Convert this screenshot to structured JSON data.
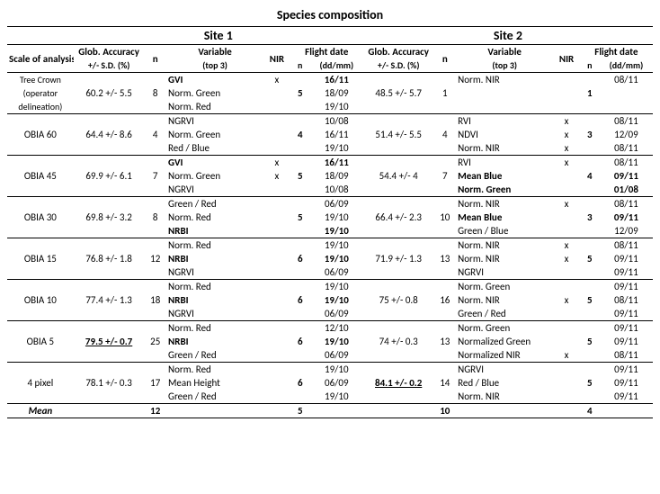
{
  "title": "Species composition",
  "sites": [
    "Site 1",
    "Site 2"
  ],
  "headers": {
    "scale": "Scale of analysis",
    "acc": "Glob. Accuracy",
    "acc_sub": "+/- S.D. (%)",
    "n": "n",
    "variable": "Variable",
    "var_sub": "(top 3)",
    "nir": "NIR",
    "flight": "Flight date",
    "flight_sub": "(dd/mm)"
  },
  "rows": [
    {
      "scale": [
        "Tree Crown",
        "(operator",
        "delineation)"
      ],
      "s1": {
        "acc": "60.2 +/- 5.5",
        "n": "8",
        "vars": [
          "GVI",
          "Norm. Green",
          "Norm. Red"
        ],
        "var_bold": [
          true,
          false,
          false
        ],
        "nir": [
          "x",
          "",
          ""
        ],
        "fn": "5",
        "fd": [
          "16/11",
          "18/09",
          "19/10"
        ],
        "fd_bold": [
          true,
          false,
          false
        ]
      },
      "s2": {
        "acc": "48.5 +/- 5.7",
        "n": "1",
        "vars": [
          "Norm. NIR",
          "",
          ""
        ],
        "var_bold": [
          false,
          false,
          false
        ],
        "nir": [
          "",
          "",
          ""
        ],
        "fn": "1",
        "fd": [
          "08/11",
          "",
          ""
        ],
        "fd_bold": [
          false,
          false,
          false
        ]
      }
    },
    {
      "scale": [
        "OBIA 60",
        "",
        ""
      ],
      "s1": {
        "acc": "64.4 +/- 8.6",
        "n": "4",
        "vars": [
          "NGRVI",
          "Norm. Green",
          "Red / Blue"
        ],
        "var_bold": [
          false,
          false,
          false
        ],
        "nir": [
          "",
          "",
          ""
        ],
        "fn": "4",
        "fd": [
          "10/08",
          "16/11",
          "19/10"
        ],
        "fd_bold": [
          false,
          false,
          false
        ]
      },
      "s2": {
        "acc": "51.4 +/- 5.5",
        "n": "4",
        "vars": [
          "RVI",
          "NDVI",
          "Norm. NIR"
        ],
        "var_bold": [
          false,
          false,
          false
        ],
        "nir": [
          "x",
          "x",
          "x"
        ],
        "fn": "3",
        "fd": [
          "08/11",
          "12/09",
          "08/11"
        ],
        "fd_bold": [
          false,
          false,
          false
        ]
      }
    },
    {
      "scale": [
        "OBIA 45",
        "",
        ""
      ],
      "s1": {
        "acc": "69.9 +/- 6.1",
        "n": "7",
        "vars": [
          "GVI",
          "Norm. Green",
          "NGRVI"
        ],
        "var_bold": [
          true,
          false,
          false
        ],
        "nir": [
          "x",
          "x",
          ""
        ],
        "fn": "5",
        "fd": [
          "16/11",
          "18/09",
          "10/08"
        ],
        "fd_bold": [
          true,
          false,
          false
        ]
      },
      "s2": {
        "acc": "54.4 +/- 4",
        "n": "7",
        "vars": [
          "RVI",
          "Mean Blue",
          "Norm. Green"
        ],
        "var_bold": [
          false,
          true,
          true
        ],
        "nir": [
          "x",
          "",
          ""
        ],
        "fn": "4",
        "fd": [
          "08/11",
          "09/11",
          "01/08"
        ],
        "fd_bold": [
          false,
          true,
          true
        ]
      }
    },
    {
      "scale": [
        "OBIA 30",
        "",
        ""
      ],
      "s1": {
        "acc": "69.8 +/- 3.2",
        "n": "8",
        "vars": [
          "Green / Red",
          "Norm. Red",
          "NRBI"
        ],
        "var_bold": [
          false,
          false,
          true
        ],
        "nir": [
          "",
          "",
          ""
        ],
        "fn": "5",
        "fd": [
          "06/09",
          "19/10",
          "19/10"
        ],
        "fd_bold": [
          false,
          false,
          true
        ]
      },
      "s2": {
        "acc": "66.4 +/- 2.3",
        "n": "10",
        "vars": [
          "Norm. NIR",
          "Mean Blue",
          "Green / Blue"
        ],
        "var_bold": [
          false,
          true,
          false
        ],
        "nir": [
          "x",
          "",
          ""
        ],
        "fn": "3",
        "fd": [
          "08/11",
          "09/11",
          "12/09"
        ],
        "fd_bold": [
          false,
          true,
          false
        ]
      }
    },
    {
      "scale": [
        "OBIA 15",
        "",
        ""
      ],
      "s1": {
        "acc": "76.8 +/- 1.8",
        "n": "12",
        "vars": [
          "Norm. Red",
          "NRBI",
          "NGRVI"
        ],
        "var_bold": [
          false,
          true,
          false
        ],
        "nir": [
          "",
          "",
          ""
        ],
        "fn": "6",
        "fd": [
          "19/10",
          "19/10",
          "06/09"
        ],
        "fd_bold": [
          false,
          true,
          false
        ]
      },
      "s2": {
        "acc": "71.9 +/- 1.3",
        "n": "13",
        "vars": [
          "Norm. NIR",
          "Norm. NIR",
          "NGRVI"
        ],
        "var_bold": [
          false,
          false,
          false
        ],
        "nir": [
          "x",
          "x",
          ""
        ],
        "fn": "5",
        "fd": [
          "08/11",
          "09/11",
          "09/11"
        ],
        "fd_bold": [
          false,
          false,
          false
        ]
      }
    },
    {
      "scale": [
        "OBIA 10",
        "",
        ""
      ],
      "s1": {
        "acc": "77.4 +/- 1.3",
        "n": "18",
        "vars": [
          "Norm. Red",
          "NRBI",
          "NGRVI"
        ],
        "var_bold": [
          false,
          true,
          false
        ],
        "nir": [
          "",
          "",
          ""
        ],
        "fn": "6",
        "fd": [
          "19/10",
          "19/10",
          "06/09"
        ],
        "fd_bold": [
          false,
          true,
          false
        ]
      },
      "s2": {
        "acc": "75 +/- 0.8",
        "n": "16",
        "vars": [
          "Norm. Green",
          "Norm. NIR",
          "Green / Red"
        ],
        "var_bold": [
          false,
          false,
          false
        ],
        "nir": [
          "",
          "x",
          ""
        ],
        "fn": "5",
        "fd": [
          "09/11",
          "08/11",
          "09/11"
        ],
        "fd_bold": [
          false,
          false,
          false
        ]
      }
    },
    {
      "scale": [
        "OBIA 5",
        "",
        ""
      ],
      "s1": {
        "acc": "79.5 +/- 0.7",
        "acc_bu": true,
        "n": "25",
        "vars": [
          "Norm. Red",
          "NRBI",
          "Green / Red"
        ],
        "var_bold": [
          false,
          true,
          false
        ],
        "nir": [
          "",
          "",
          ""
        ],
        "fn": "6",
        "fd": [
          "12/10",
          "19/10",
          "06/09"
        ],
        "fd_bold": [
          false,
          true,
          false
        ]
      },
      "s2": {
        "acc": "74 +/- 0.3",
        "n": "13",
        "vars": [
          "Norm. Green",
          "Normalized Green",
          "Normalized NIR"
        ],
        "var_bold": [
          false,
          false,
          false
        ],
        "nir": [
          "",
          "",
          "x"
        ],
        "fn": "5",
        "fd": [
          "09/11",
          "09/11",
          "08/11"
        ],
        "fd_bold": [
          false,
          false,
          false
        ]
      }
    },
    {
      "scale": [
        "4 pixel",
        "",
        ""
      ],
      "s1": {
        "acc": "78.1 +/- 0.3",
        "n": "17",
        "vars": [
          "Norm. Red",
          "Mean Height",
          "Green / Red"
        ],
        "var_bold": [
          false,
          false,
          false
        ],
        "nir": [
          "",
          "",
          ""
        ],
        "fn": "6",
        "fd": [
          "19/10",
          "06/09",
          "19/10"
        ],
        "fd_bold": [
          false,
          false,
          false
        ]
      },
      "s2": {
        "acc": "84.1 +/- 0.2",
        "acc_bu": true,
        "n": "14",
        "vars": [
          "NGRVI",
          "Red / Blue",
          "Norm. NIR"
        ],
        "var_bold": [
          false,
          false,
          false
        ],
        "nir": [
          "",
          "",
          ""
        ],
        "fn": "5",
        "fd": [
          "09/11",
          "09/11",
          "09/11"
        ],
        "fd_bold": [
          false,
          false,
          false
        ]
      }
    }
  ],
  "mean": {
    "label": "Mean",
    "s1_n": "12",
    "s1_fn": "5",
    "s2_n": "10",
    "s2_fn": "4"
  }
}
